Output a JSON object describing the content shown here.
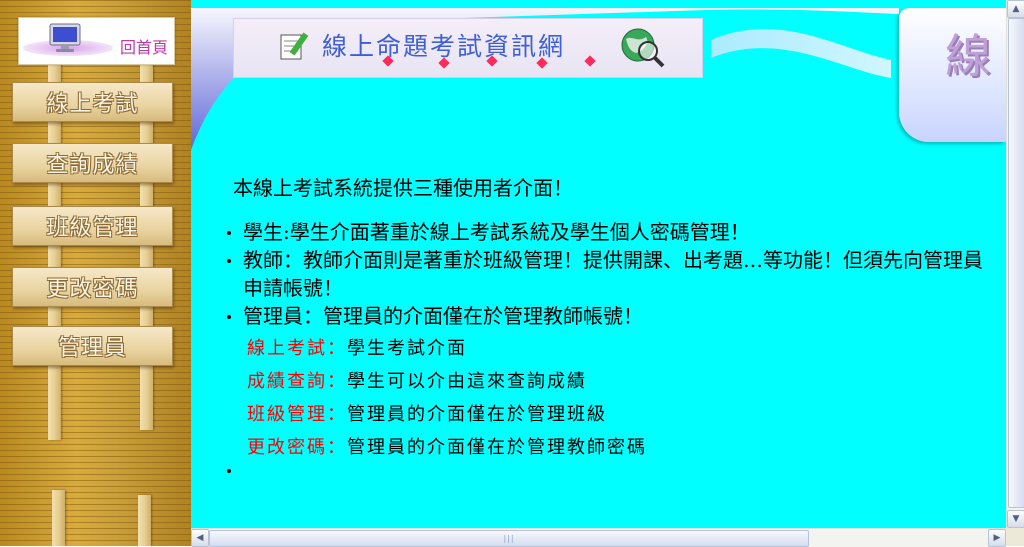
{
  "sidebar": {
    "home_label": "回首頁",
    "items": [
      {
        "label": "線上考試"
      },
      {
        "label": "查詢成績"
      },
      {
        "label": "班級管理"
      },
      {
        "label": "更改密碼"
      },
      {
        "label": "管理員"
      }
    ]
  },
  "banner": {
    "title": "線上命題考試資訊網",
    "right_glyph": "線"
  },
  "content": {
    "intro": "本線上考試系統提供三種使用者介面！",
    "roles": [
      {
        "text": "學生:學生介面著重於線上考試系統及學生個人密碼管理！"
      },
      {
        "text": "教師：教師介面則是著重於班級管理！提供開課、出考題…等功能！但須先向管理員申請帳號！"
      },
      {
        "text": "管理員：管理員的介面僅在於管理教師帳號！"
      }
    ],
    "definitions": [
      {
        "term": "線上考試",
        "sep": "：",
        "desc": "學生考試介面"
      },
      {
        "term": "成績查詢",
        "sep": "：",
        "desc": "學生可以介由這來查詢成績"
      },
      {
        "term": "班級管理",
        "sep": "：",
        "desc": "管理員的介面僅在於管理班級"
      },
      {
        "term": "更改密碼",
        "sep": "：",
        "desc": "管理員的介面僅在於管理教師密碼"
      }
    ]
  },
  "colors": {
    "content_background": "#00ffff",
    "term_color": "#ff0000",
    "title_color": "#3e5fd6"
  },
  "icons": {
    "home": "computer-monitor-icon",
    "title_left": "notepad-pencil-icon",
    "title_right": "globe-magnifier-icon"
  }
}
